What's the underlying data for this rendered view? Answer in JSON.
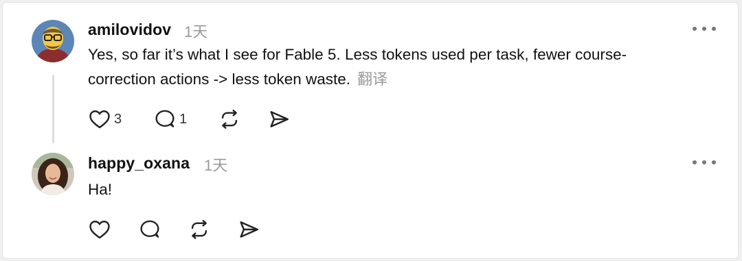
{
  "comments": [
    {
      "username": "amilovidov",
      "timestamp": "1天",
      "text_line1": "Yes, so far it’s what I see for Fable 5. Less tokens used per task, fewer course-",
      "text_line2": "correction actions -> less token waste.",
      "translate_label": "翻译",
      "like_count": "3",
      "reply_count": "1"
    },
    {
      "username": "happy_oxana",
      "timestamp": "1天",
      "text_line1": "Ha!"
    }
  ],
  "icons": [
    "heart-icon",
    "comment-icon",
    "repost-icon",
    "share-icon",
    "more-icon"
  ],
  "colors": {
    "text": "#111111",
    "muted": "#999999",
    "line": "#dcdcdc",
    "background": "#ffffff"
  }
}
